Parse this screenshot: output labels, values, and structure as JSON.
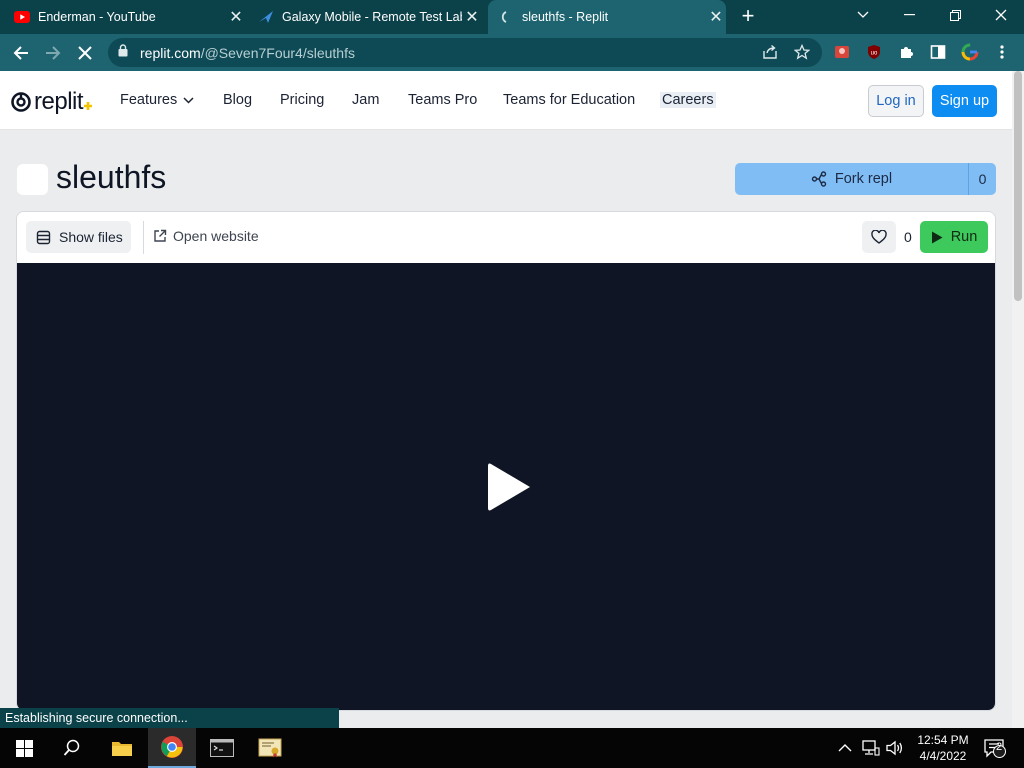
{
  "browser": {
    "tabs": [
      {
        "title": "Enderman - YouTube",
        "favicon": "youtube-icon"
      },
      {
        "title": "Galaxy Mobile - Remote Test Lab",
        "favicon": "galaxy-icon"
      },
      {
        "title": "sleuthfs - Replit",
        "favicon": "loading-icon",
        "active": true
      }
    ],
    "new_tab": "+",
    "url_host": "replit.com",
    "url_path": "/@Seven7Four4/sleuthfs",
    "status": "Establishing secure connection..."
  },
  "site": {
    "logo_text": "replit",
    "nav": {
      "features": "Features",
      "blog": "Blog",
      "pricing": "Pricing",
      "jam": "Jam",
      "teams_pro": "Teams Pro",
      "teams_edu": "Teams for Education",
      "careers": "Careers"
    },
    "login": "Log in",
    "signup": "Sign up"
  },
  "repl": {
    "title": "sleuthfs",
    "fork_label": "Fork repl",
    "fork_count": "0",
    "show_files": "Show files",
    "open_website": "Open website",
    "like_count": "0",
    "run_label": "Run"
  },
  "taskbar": {
    "time": "12:54 PM",
    "date": "4/4/2022",
    "notifications": "2"
  },
  "colors": {
    "browser_frame": "#0b4149",
    "browser_toolbar": "#1d6470",
    "signup_blue": "#0d8cf2",
    "fork_blue": "#80bdf5",
    "run_green": "#3ec95c",
    "preview_bg": "#0f1524"
  }
}
